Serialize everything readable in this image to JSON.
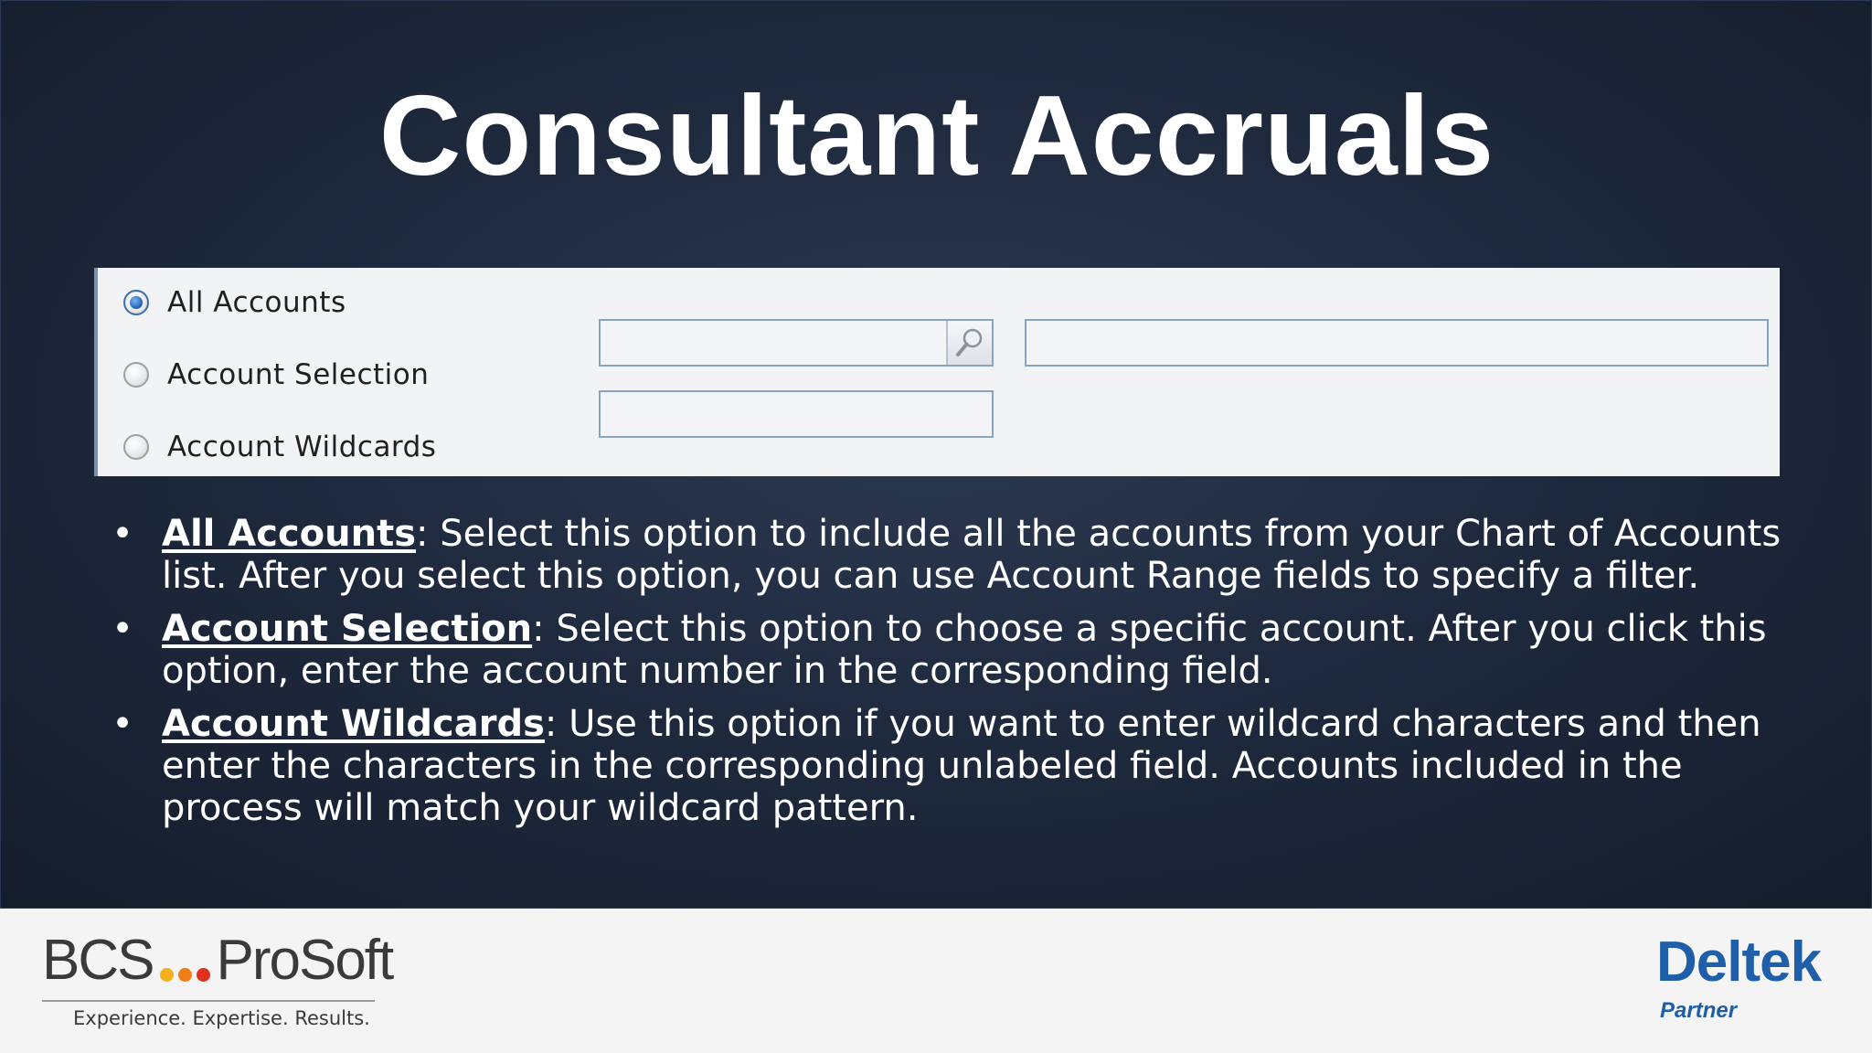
{
  "slide": {
    "title": "Consultant Accruals"
  },
  "panel": {
    "options": [
      {
        "label": "All Accounts",
        "selected": true
      },
      {
        "label": "Account Selection",
        "selected": false
      },
      {
        "label": "Account Wildcards",
        "selected": false
      }
    ],
    "account_selection_value": "",
    "account_description_value": "",
    "account_wildcards_value": "",
    "lookup_icon": "magnifier-icon"
  },
  "bullets": [
    {
      "term": "All Accounts",
      "text": ": Select this option to include all the accounts from your Chart of Accounts list. After you select this option, you can use Account Range fields to specify a filter."
    },
    {
      "term": "Account Selection",
      "text": ": Select this option to choose a specific account. After you click this option, enter the account number in the corresponding field."
    },
    {
      "term": "Account Wildcards",
      "text": ": Use this option if you want to enter wildcard characters and then enter the characters in the corresponding unlabeled field. Accounts included in the process will match your wildcard pattern."
    }
  ],
  "footer": {
    "bcs_left": "BCS",
    "bcs_right": "ProSoft",
    "bcs_tagline": "Experience. Expertise. Results.",
    "bcs_dot_colors": [
      "#f2b01e",
      "#ef7d1a",
      "#e0301e"
    ],
    "deltek_name": "Deltek",
    "deltek_partner": "Partner"
  },
  "colors": {
    "background": "#1f2a3e",
    "deltek_blue": "#1f5ea8"
  }
}
